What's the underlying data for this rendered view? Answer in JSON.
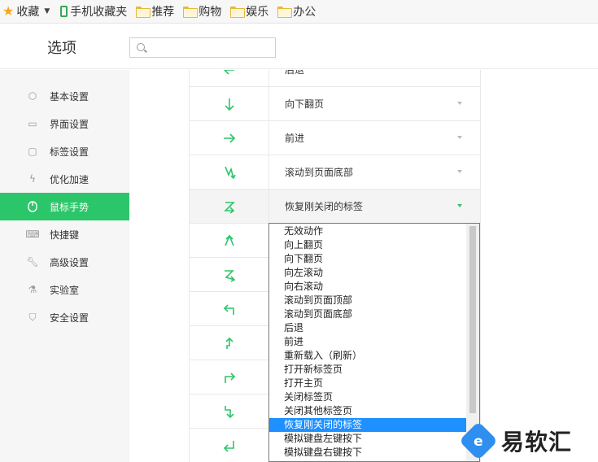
{
  "bookmarks": [
    {
      "label": "收藏",
      "icon": "star-icon"
    },
    {
      "label": "手机收藏夹",
      "icon": "phone-icon"
    },
    {
      "label": "推荐",
      "icon": "folder-icon"
    },
    {
      "label": "购物",
      "icon": "folder-icon"
    },
    {
      "label": "娱乐",
      "icon": "folder-icon"
    },
    {
      "label": "办公",
      "icon": "folder-icon"
    }
  ],
  "header": {
    "title": "选项",
    "search_placeholder": ""
  },
  "sidebar": {
    "items": [
      {
        "label": "基本设置",
        "icon": "hexagon-icon"
      },
      {
        "label": "界面设置",
        "icon": "window-icon"
      },
      {
        "label": "标签设置",
        "icon": "tab-icon"
      },
      {
        "label": "优化加速",
        "icon": "lightning-icon"
      },
      {
        "label": "鼠标手势",
        "icon": "mouse-icon",
        "active": true
      },
      {
        "label": "快捷键",
        "icon": "keyboard-icon"
      },
      {
        "label": "高级设置",
        "icon": "wrench-icon"
      },
      {
        "label": "实验室",
        "icon": "flask-icon"
      },
      {
        "label": "安全设置",
        "icon": "shield-icon"
      }
    ]
  },
  "gestures": [
    {
      "gesture": "left-arrow-gesture",
      "action": "后退"
    },
    {
      "gesture": "down-arrow-gesture",
      "action": "向下翻页"
    },
    {
      "gesture": "right-arrow-gesture",
      "action": "前进"
    },
    {
      "gesture": "down-up-down-gesture",
      "action": "滚动到页面底部"
    },
    {
      "gesture": "z-gesture",
      "action": "恢复刚关闭的标签",
      "highlighted": true
    },
    {
      "gesture": "up-right-gesture",
      "action": ""
    },
    {
      "gesture": "down-right-gesture",
      "action": ""
    },
    {
      "gesture": "up-left-gesture",
      "action": ""
    },
    {
      "gesture": "up-gesture",
      "action": ""
    },
    {
      "gesture": "up-then-right-gesture",
      "action": ""
    },
    {
      "gesture": "down-then-right-gesture",
      "action": ""
    },
    {
      "gesture": "down-then-left-gesture",
      "action": ""
    }
  ],
  "dropdown": {
    "options": [
      "无效动作",
      "向上翻页",
      "向下翻页",
      "向左滚动",
      "向右滚动",
      "滚动到页面顶部",
      "滚动到页面底部",
      "后退",
      "前进",
      "重新载入（刷新）",
      "打开新标签页",
      "打开主页",
      "关闭标签页",
      "关闭其他标签页",
      "恢复刚关闭的标签",
      "模拟键盘左键按下",
      "模拟键盘右键按下"
    ],
    "selected": "恢复刚关闭的标签"
  },
  "watermark": {
    "text": "易软汇",
    "logo_letter": "e"
  },
  "colors": {
    "accent": "#2cc66a",
    "selection": "#1e90ff"
  }
}
